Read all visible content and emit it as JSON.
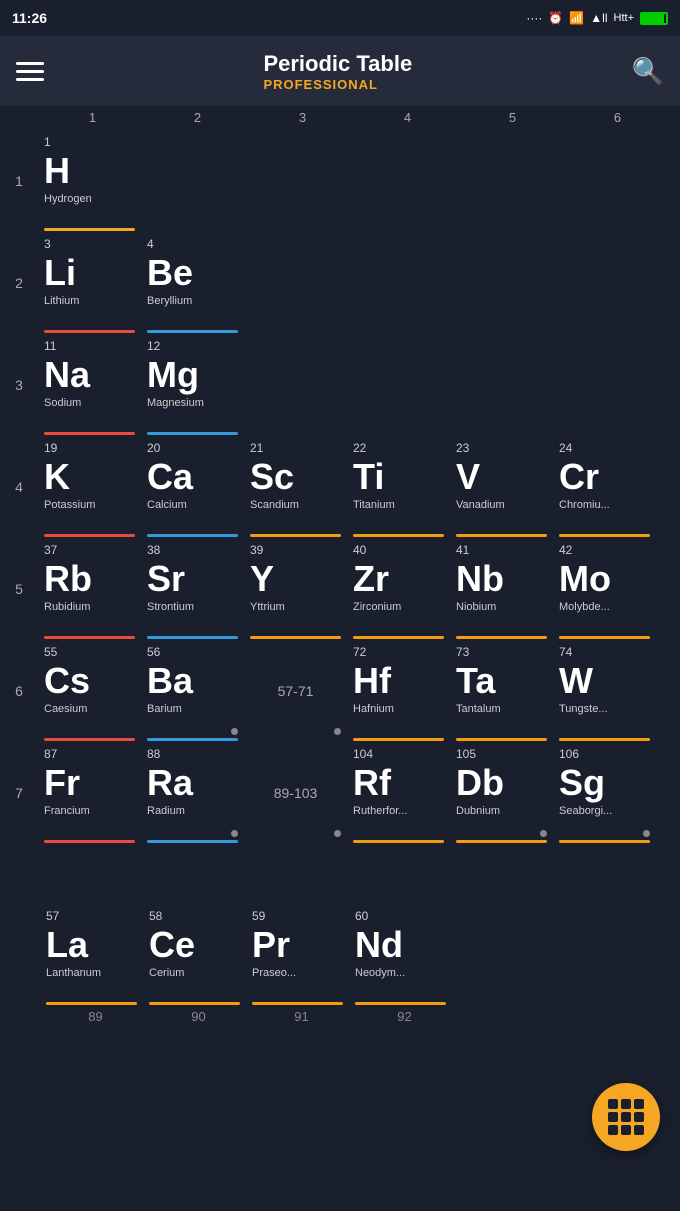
{
  "status": {
    "time": "11:26",
    "signal": "....",
    "icons": [
      "⏰",
      "📶",
      "🔋"
    ]
  },
  "header": {
    "title": "Periodic Table",
    "subtitle": "PROFESSIONAL",
    "menu_label": "Menu",
    "search_label": "Search"
  },
  "columns": [
    "1",
    "2",
    "3",
    "4",
    "5",
    "6"
  ],
  "rows": [
    {
      "period": "1",
      "cells": [
        {
          "atomic": "1",
          "symbol": "H",
          "name": "Hydrogen",
          "type": "nonmetal",
          "col": 1
        },
        {
          "atomic": "",
          "symbol": "",
          "name": "",
          "type": "empty",
          "col": 2
        }
      ]
    },
    {
      "period": "2",
      "cells": [
        {
          "atomic": "3",
          "symbol": "Li",
          "name": "Lithium",
          "type": "alkali-metal",
          "col": 1
        },
        {
          "atomic": "4",
          "symbol": "Be",
          "name": "Beryllium",
          "type": "alkaline-earth",
          "col": 2
        }
      ]
    },
    {
      "period": "3",
      "cells": [
        {
          "atomic": "11",
          "symbol": "Na",
          "name": "Sodium",
          "type": "alkali-metal",
          "col": 1
        },
        {
          "atomic": "12",
          "symbol": "Mg",
          "name": "Magnesium",
          "type": "alkaline-earth",
          "col": 2
        }
      ]
    },
    {
      "period": "4",
      "cells": [
        {
          "atomic": "19",
          "symbol": "K",
          "name": "Potassium",
          "type": "alkali-metal",
          "col": 1
        },
        {
          "atomic": "20",
          "symbol": "Ca",
          "name": "Calcium",
          "type": "alkaline-earth",
          "col": 2
        },
        {
          "atomic": "21",
          "symbol": "Sc",
          "name": "Scandium",
          "type": "transition",
          "col": 3
        },
        {
          "atomic": "22",
          "symbol": "Ti",
          "name": "Titanium",
          "type": "transition",
          "col": 4
        },
        {
          "atomic": "23",
          "symbol": "V",
          "name": "Vanadium",
          "type": "transition",
          "col": 5
        },
        {
          "atomic": "24",
          "symbol": "Cr",
          "name": "Chromiu...",
          "type": "transition",
          "col": 6
        }
      ]
    },
    {
      "period": "5",
      "cells": [
        {
          "atomic": "37",
          "symbol": "Rb",
          "name": "Rubidium",
          "type": "alkali-metal",
          "col": 1
        },
        {
          "atomic": "38",
          "symbol": "Sr",
          "name": "Strontium",
          "type": "alkaline-earth",
          "col": 2
        },
        {
          "atomic": "39",
          "symbol": "Y",
          "name": "Yttrium",
          "type": "transition",
          "col": 3
        },
        {
          "atomic": "40",
          "symbol": "Zr",
          "name": "Zirconium",
          "type": "transition",
          "col": 4
        },
        {
          "atomic": "41",
          "symbol": "Nb",
          "name": "Niobium",
          "type": "transition",
          "col": 5
        },
        {
          "atomic": "42",
          "symbol": "Mo",
          "name": "Molybde...",
          "type": "transition",
          "col": 6
        }
      ]
    },
    {
      "period": "6",
      "cells": [
        {
          "atomic": "55",
          "symbol": "Cs",
          "name": "Caesium",
          "type": "alkali-metal",
          "col": 1
        },
        {
          "atomic": "56",
          "symbol": "Ba",
          "name": "Barium",
          "type": "alkaline-earth",
          "col": 2
        },
        {
          "atomic": "57-71",
          "symbol": "",
          "name": "",
          "type": "range",
          "col": 3
        },
        {
          "atomic": "72",
          "symbol": "Hf",
          "name": "Hafnium",
          "type": "transition",
          "col": 4
        },
        {
          "atomic": "73",
          "symbol": "Ta",
          "name": "Tantalum",
          "type": "transition",
          "col": 5
        },
        {
          "atomic": "74",
          "symbol": "W",
          "name": "Tungste...",
          "type": "transition",
          "col": 6
        }
      ]
    },
    {
      "period": "7",
      "cells": [
        {
          "atomic": "87",
          "symbol": "Fr",
          "name": "Francium",
          "type": "alkali-metal",
          "col": 1
        },
        {
          "atomic": "88",
          "symbol": "Ra",
          "name": "Radium",
          "type": "alkaline-earth",
          "col": 2
        },
        {
          "atomic": "89-103",
          "symbol": "",
          "name": "",
          "type": "range",
          "col": 3
        },
        {
          "atomic": "104",
          "symbol": "Rf",
          "name": "Rutherfor...",
          "type": "transition",
          "col": 4
        },
        {
          "atomic": "105",
          "symbol": "Db",
          "name": "Dubnium",
          "type": "transition",
          "col": 5
        },
        {
          "atomic": "106",
          "symbol": "Sg",
          "name": "Seaborgi...",
          "type": "transition",
          "col": 6
        }
      ]
    }
  ],
  "lanthanides": [
    {
      "atomic": "57",
      "symbol": "La",
      "name": "Lanthanum",
      "type": "transition"
    },
    {
      "atomic": "58",
      "symbol": "Ce",
      "name": "Cerium",
      "type": "transition"
    },
    {
      "atomic": "59",
      "symbol": "Pr",
      "name": "Praseo...",
      "type": "transition"
    },
    {
      "atomic": "60",
      "symbol": "Nd",
      "name": "Neodym...",
      "type": "transition"
    }
  ],
  "actinides_row2_labels": [
    "89",
    "90",
    "91",
    "92"
  ],
  "fab": {
    "label": "Grid View"
  }
}
